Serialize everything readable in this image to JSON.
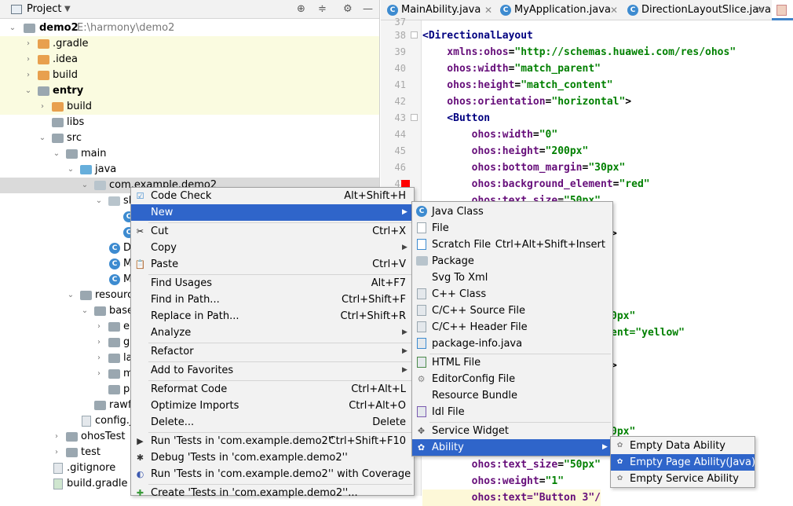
{
  "project_panel": {
    "title": "Project",
    "dropdown_icon": "chevron-down-icon",
    "toolbar_icons": [
      "locate-icon",
      "collapse-icon",
      "gear-icon",
      "minimize-icon"
    ],
    "tree": [
      {
        "label": "demo2",
        "path": "E:\\harmony\\demo2"
      },
      {
        "label": ".gradle"
      },
      {
        "label": ".idea"
      },
      {
        "label": "build"
      },
      {
        "label": "entry"
      },
      {
        "label": "build"
      },
      {
        "label": "libs"
      },
      {
        "label": "src"
      },
      {
        "label": "main"
      },
      {
        "label": "java"
      },
      {
        "label": "com.example.demo2"
      },
      {
        "label": "sl"
      },
      {
        "label": ""
      },
      {
        "label": ""
      },
      {
        "label": "D"
      },
      {
        "label": "M"
      },
      {
        "label": "M"
      },
      {
        "label": "resourc"
      },
      {
        "label": "base"
      },
      {
        "label": "el"
      },
      {
        "label": "gr"
      },
      {
        "label": "la"
      },
      {
        "label": "m"
      },
      {
        "label": "pr"
      },
      {
        "label": "rawfi"
      },
      {
        "label": "config.js"
      },
      {
        "label": "ohosTest"
      },
      {
        "label": "test"
      },
      {
        "label": ".gitignore"
      },
      {
        "label": "build.gradle"
      }
    ]
  },
  "editor": {
    "tabs": [
      "MainAbility.java",
      "MyApplication.java",
      "DirectionLayoutSlice.java"
    ],
    "line_numbers": [
      "37",
      "38",
      "39",
      "40",
      "41",
      "42",
      "43",
      "44",
      "45",
      "46",
      "47"
    ],
    "code_lines": [
      {
        "parts": [
          {
            "t": "",
            "c": "pl"
          }
        ]
      },
      {
        "parts": [
          {
            "t": "<",
            "c": "tg"
          },
          {
            "t": "DirectionalLayout",
            "c": "tg"
          }
        ]
      },
      {
        "parts": [
          {
            "t": "    xmlns:ohos",
            "c": "at"
          },
          {
            "t": "=",
            "c": "pl"
          },
          {
            "t": "\"http://schemas.huawei.com/res/ohos\"",
            "c": "st"
          }
        ]
      },
      {
        "parts": [
          {
            "t": "    ohos:width",
            "c": "at"
          },
          {
            "t": "=",
            "c": "pl"
          },
          {
            "t": "\"match_parent\"",
            "c": "st"
          }
        ]
      },
      {
        "parts": [
          {
            "t": "    ohos:height",
            "c": "at"
          },
          {
            "t": "=",
            "c": "pl"
          },
          {
            "t": "\"match_content\"",
            "c": "st"
          }
        ]
      },
      {
        "parts": [
          {
            "t": "    ohos:orientation",
            "c": "at"
          },
          {
            "t": "=",
            "c": "pl"
          },
          {
            "t": "\"horizontal\"",
            "c": "st"
          },
          {
            "t": ">",
            "c": "pl"
          }
        ]
      },
      {
        "parts": [
          {
            "t": "    <Button",
            "c": "tg"
          }
        ]
      },
      {
        "parts": [
          {
            "t": "        ohos:width",
            "c": "at"
          },
          {
            "t": "=",
            "c": "pl"
          },
          {
            "t": "\"0\"",
            "c": "st"
          }
        ]
      },
      {
        "parts": [
          {
            "t": "        ohos:height",
            "c": "at"
          },
          {
            "t": "=",
            "c": "pl"
          },
          {
            "t": "\"200px\"",
            "c": "st"
          }
        ]
      },
      {
        "parts": [
          {
            "t": "        ohos:bottom_margin",
            "c": "at"
          },
          {
            "t": "=",
            "c": "pl"
          },
          {
            "t": "\"30px\"",
            "c": "st"
          }
        ]
      },
      {
        "parts": [
          {
            "t": "        ohos:background_element",
            "c": "at"
          },
          {
            "t": "=",
            "c": "pl"
          },
          {
            "t": "\"red\"",
            "c": "st"
          }
        ]
      },
      {
        "parts": [
          {
            "t": "        ohos:text_size",
            "c": "at"
          },
          {
            "t": "=",
            "c": "pl"
          },
          {
            "t": "\"50px\"",
            "c": "st"
          }
        ]
      }
    ],
    "fragments": [
      {
        "text": ">",
        "c": "pl"
      },
      {
        "text": "0px\"",
        "c": "st"
      },
      {
        "text": "ent=\"yellow\"",
        "c": "st"
      },
      {
        "text": ">",
        "c": "pl"
      },
      {
        "text": "0px\"",
        "c": "st"
      }
    ],
    "bottom_lines": [
      {
        "parts": [
          {
            "t": "        ohos:text_size",
            "c": "at"
          },
          {
            "t": "=",
            "c": "pl"
          },
          {
            "t": "\"50px\"",
            "c": "st"
          }
        ]
      },
      {
        "parts": [
          {
            "t": "        ohos:weight",
            "c": "at"
          },
          {
            "t": "=",
            "c": "pl"
          },
          {
            "t": "\"1\"",
            "c": "st"
          }
        ]
      },
      {
        "parts": [
          {
            "t": "        ohos:text=\"Button 3\"/",
            "c": "at"
          }
        ]
      }
    ]
  },
  "context_menu": {
    "items": [
      {
        "label": "Code Check",
        "shortcut": "Alt+Shift+H",
        "icon": "code-check-icon"
      },
      {
        "label": "New",
        "shortcut": "",
        "submenu": true
      },
      {
        "label": "Cut",
        "shortcut": "Ctrl+X",
        "icon": "scissors-icon"
      },
      {
        "label": "Copy",
        "shortcut": "",
        "submenu": true
      },
      {
        "label": "Paste",
        "shortcut": "Ctrl+V",
        "icon": "paste-icon"
      },
      {
        "label": "Find Usages",
        "shortcut": "Alt+F7"
      },
      {
        "label": "Find in Path...",
        "shortcut": "Ctrl+Shift+F"
      },
      {
        "label": "Replace in Path...",
        "shortcut": "Ctrl+Shift+R"
      },
      {
        "label": "Analyze",
        "shortcut": "",
        "submenu": true
      },
      {
        "label": "Refactor",
        "shortcut": "",
        "submenu": true
      },
      {
        "label": "Add to Favorites",
        "shortcut": "",
        "submenu": true
      },
      {
        "label": "Reformat Code",
        "shortcut": "Ctrl+Alt+L"
      },
      {
        "label": "Optimize Imports",
        "shortcut": "Ctrl+Alt+O"
      },
      {
        "label": "Delete...",
        "shortcut": "Delete"
      },
      {
        "label": "Run 'Tests in 'com.example.demo2''",
        "shortcut": "Ctrl+Shift+F10",
        "icon": "run-icon"
      },
      {
        "label": "Debug 'Tests in 'com.example.demo2''",
        "shortcut": "",
        "icon": "debug-icon"
      },
      {
        "label": "Run 'Tests in 'com.example.demo2'' with Coverage",
        "shortcut": "",
        "icon": "coverage-icon"
      },
      {
        "label": "Create 'Tests in 'com.example.demo2''...",
        "shortcut": "",
        "icon": "create-test-icon"
      }
    ]
  },
  "new_submenu": {
    "items": [
      {
        "label": "Java Class",
        "shortcut": ""
      },
      {
        "label": "File",
        "shortcut": ""
      },
      {
        "label": "Scratch File",
        "shortcut": "Ctrl+Alt+Shift+Insert"
      },
      {
        "label": "Package",
        "shortcut": ""
      },
      {
        "label": "Svg To Xml",
        "shortcut": ""
      },
      {
        "label": "C++ Class",
        "shortcut": ""
      },
      {
        "label": "C/C++ Source File",
        "shortcut": ""
      },
      {
        "label": "C/C++ Header File",
        "shortcut": ""
      },
      {
        "label": "package-info.java",
        "shortcut": ""
      },
      {
        "label": "HTML File",
        "shortcut": ""
      },
      {
        "label": "EditorConfig File",
        "shortcut": ""
      },
      {
        "label": "Resource Bundle",
        "shortcut": ""
      },
      {
        "label": "Idl File",
        "shortcut": ""
      },
      {
        "label": "Service Widget",
        "shortcut": ""
      },
      {
        "label": "Ability",
        "shortcut": "",
        "submenu": true
      }
    ]
  },
  "ability_submenu": {
    "items": [
      {
        "label": "Empty Data Ability"
      },
      {
        "label": "Empty Page Ability(Java)"
      },
      {
        "label": "Empty Service Ability"
      }
    ]
  }
}
